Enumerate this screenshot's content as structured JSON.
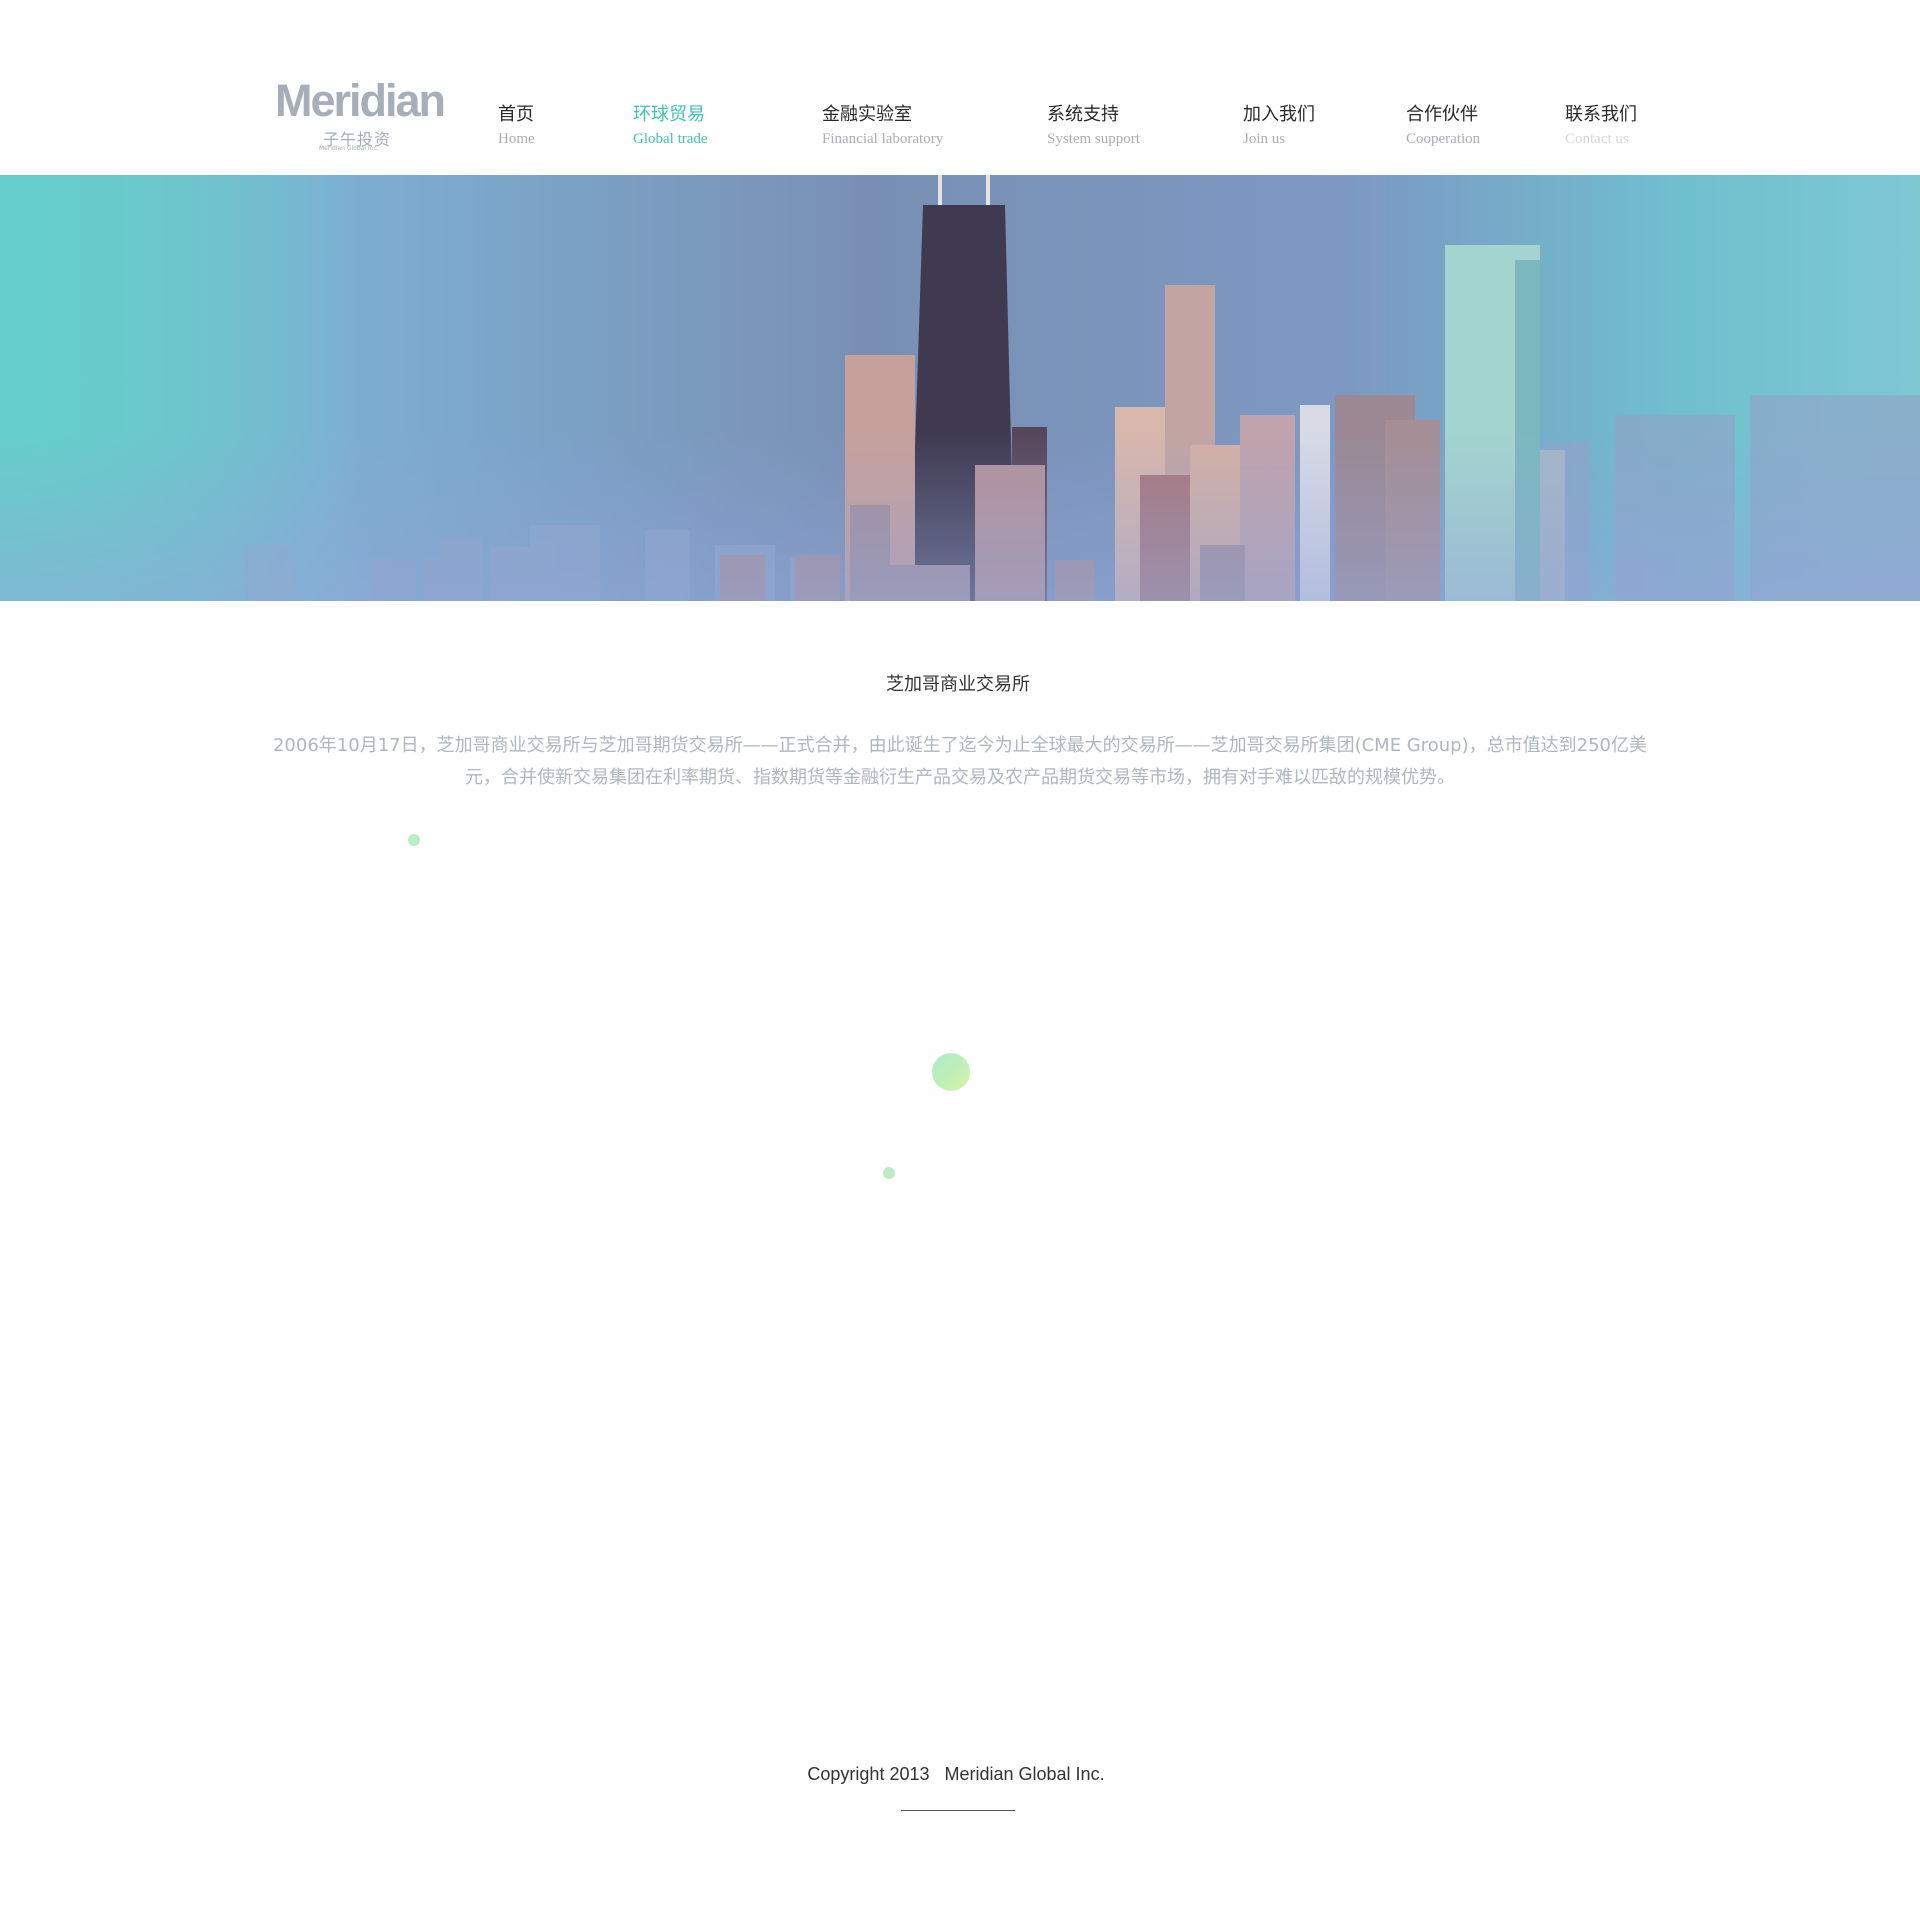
{
  "header": {
    "logo": {
      "word": "Meridian",
      "cn": "子午投资",
      "sub": "Meridian Global Inc."
    },
    "nav": [
      {
        "cn": "首页",
        "en": "Home"
      },
      {
        "cn": "环球贸易",
        "en": "Global trade",
        "active": true
      },
      {
        "cn": "金融实验室",
        "en": "Financial laboratory"
      },
      {
        "cn": "系统支持",
        "en": "System support"
      },
      {
        "cn": "加入我们",
        "en": "Join us"
      },
      {
        "cn": "合作伙伴",
        "en": "Cooperation"
      },
      {
        "cn": "联系我们",
        "en": "Contact us"
      }
    ]
  },
  "main": {
    "title": "芝加哥商业交易所",
    "body": "2006年10月17日，芝加哥商业交易所与芝加哥期货交易所——正式合并，由此诞生了迄今为止全球最大的交易所——芝加哥交易所集团(CME Group)，总市值达到250亿美元，合并使新交易集团在利率期货、指数期货等金融衍生产品交易及农产品期货交易等市场，拥有对手难以匹敌的规模优势。"
  },
  "footer": {
    "copyright": "Copyright 2013   Meridian Global Inc."
  },
  "colors": {
    "accent": "#3cc4b6",
    "body_text": "#aeb6c0",
    "dot": "#b9ecc7"
  }
}
